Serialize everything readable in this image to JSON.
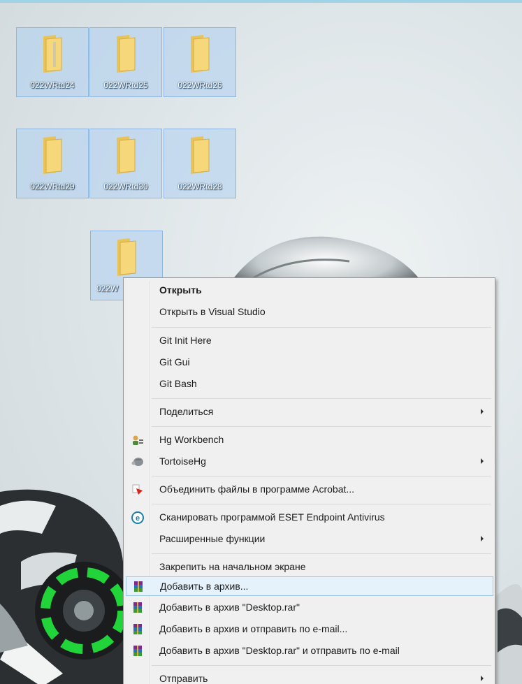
{
  "desktop": {
    "icons": [
      {
        "label": "022WRtd24"
      },
      {
        "label": "022WRtd25"
      },
      {
        "label": "022WRtd26"
      },
      {
        "label": "022WRtd29"
      },
      {
        "label": "022WRtd30"
      },
      {
        "label": "022WRtd28"
      },
      {
        "label": "022W"
      }
    ]
  },
  "context_menu": {
    "items": [
      {
        "label": "Открыть"
      },
      {
        "label": "Открыть в Visual Studio"
      },
      {
        "label": "Git Init Here"
      },
      {
        "label": "Git Gui"
      },
      {
        "label": "Git Bash"
      },
      {
        "label": "Поделиться"
      },
      {
        "label": "Hg Workbench",
        "icon": "hg-workbench-icon"
      },
      {
        "label": "TortoiseHg",
        "icon": "tortoisehg-icon"
      },
      {
        "label": "Объединить файлы в программе Acrobat...",
        "icon": "acrobat-icon"
      },
      {
        "label": "Сканировать программой ESET Endpoint Antivirus",
        "icon": "eset-icon"
      },
      {
        "label": "Расширенные функции"
      },
      {
        "label": "Закрепить на начальном экране"
      },
      {
        "label": "Добавить в архив...",
        "icon": "winrar-icon"
      },
      {
        "label": "Добавить в архив \"Desktop.rar\"",
        "icon": "winrar-icon"
      },
      {
        "label": "Добавить в архив и отправить по e-mail...",
        "icon": "winrar-icon"
      },
      {
        "label": "Добавить в архив \"Desktop.rar\" и отправить по e-mail",
        "icon": "winrar-icon"
      },
      {
        "label": "Отправить"
      }
    ],
    "highlighted_item": "Добавить в архив..."
  },
  "colors": {
    "selection_fill": "#aed0f0",
    "menu_background": "#f0f0f0",
    "menu_highlight": "#e5f1fb",
    "folder_yellow": "#f6d77a"
  }
}
